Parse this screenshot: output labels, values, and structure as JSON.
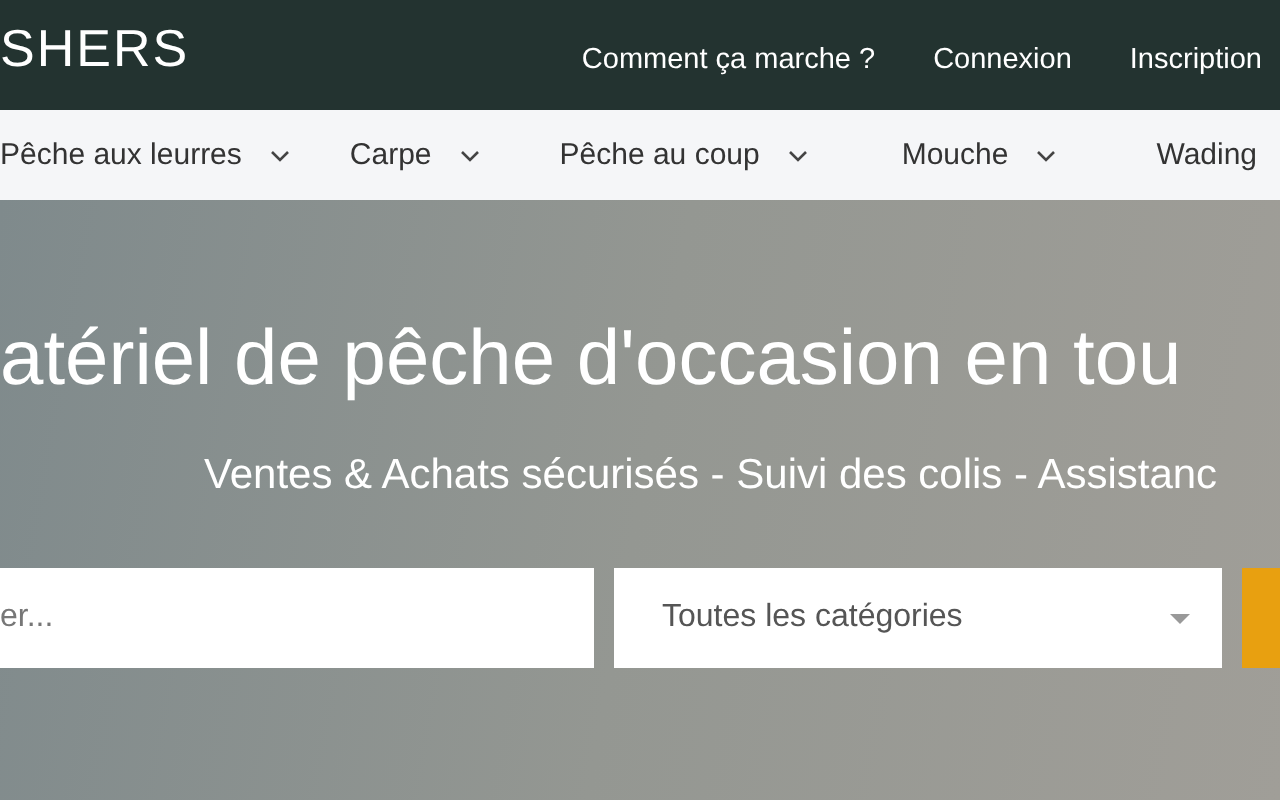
{
  "header": {
    "logo": "SHERS",
    "links": [
      "Comment ça marche ?",
      "Connexion",
      "Inscription"
    ]
  },
  "categories": [
    {
      "label": "Pêche aux leurres",
      "has_menu": true
    },
    {
      "label": "Carpe",
      "has_menu": true
    },
    {
      "label": "Pêche au coup",
      "has_menu": true
    },
    {
      "label": "Mouche",
      "has_menu": true
    },
    {
      "label": "Wading",
      "has_menu": false
    }
  ],
  "hero": {
    "title": "atériel de pêche d'occasion en tou",
    "subtitle": "Ventes & Achats sécurisés - Suivi des colis - Assistanc"
  },
  "search": {
    "placeholder": "er...",
    "category": "Toutes les catégories"
  }
}
